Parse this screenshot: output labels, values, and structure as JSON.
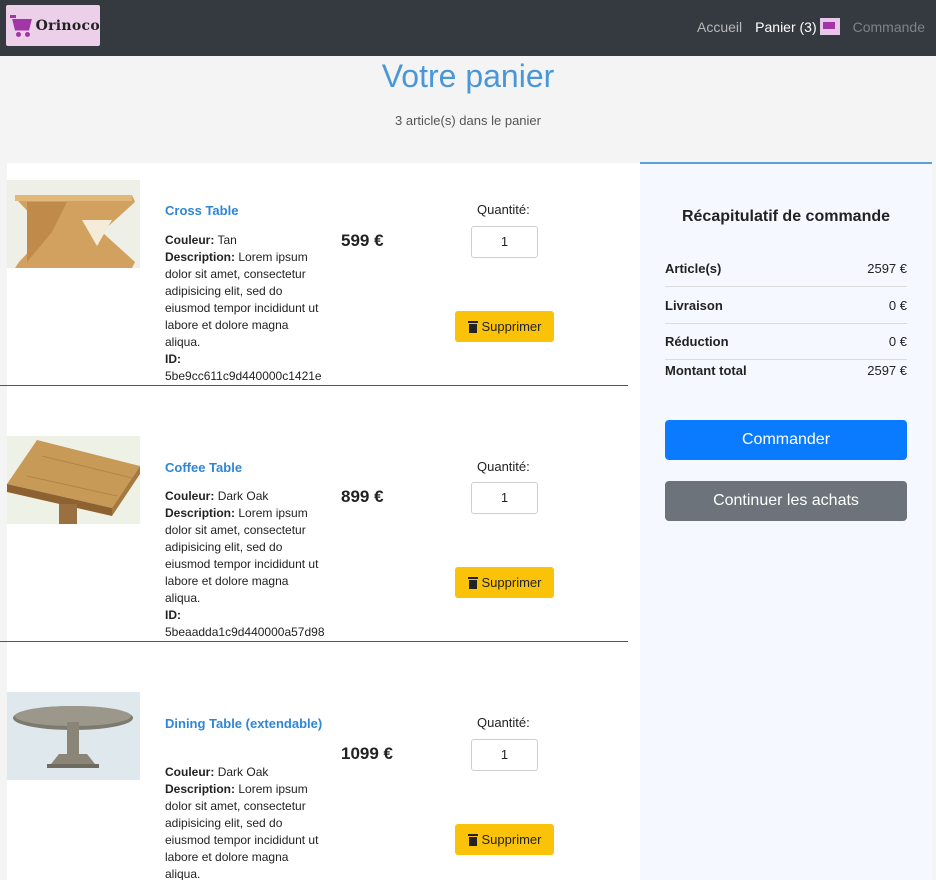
{
  "nav": {
    "logo_text": "Orinoco",
    "home": "Accueil",
    "cart": "Panier (3)",
    "order": "Commande"
  },
  "header": {
    "title": "Votre panier",
    "subtitle": "3 article(s) dans le panier"
  },
  "labels": {
    "color": "Couleur:",
    "description": "Description:",
    "id": "ID:",
    "quantity": "Quantité:",
    "delete": "Supprimer"
  },
  "items": [
    {
      "name": "Cross Table",
      "color": "Tan",
      "description": "Lorem ipsum dolor sit amet, consectetur adipisicing elit, sed do eiusmod tempor incididunt ut labore et dolore magna aliqua.",
      "id": "5be9cc611c9d440000c1421e",
      "price": "599 €",
      "quantity": "1"
    },
    {
      "name": "Coffee Table",
      "color": "Dark Oak",
      "description": "Lorem ipsum dolor sit amet, consectetur adipisicing elit, sed do eiusmod tempor incididunt ut labore et dolore magna aliqua.",
      "id": "5beaadda1c9d440000a57d98",
      "price": "899 €",
      "quantity": "1"
    },
    {
      "name": "Dining Table (extendable)",
      "color": "Dark Oak",
      "description": "Lorem ipsum dolor sit amet, consectetur adipisicing elit, sed do eiusmod tempor incididunt ut labore et dolore magna aliqua.",
      "price": "1099 €",
      "quantity": "1"
    }
  ],
  "summary": {
    "title": "Récapitulatif de commande",
    "articles_label": "Article(s)",
    "articles_value": "2597 €",
    "shipping_label": "Livraison",
    "shipping_value": "0 €",
    "discount_label": "Réduction",
    "discount_value": "0 €",
    "total_label": "Montant total",
    "total_value": "2597 €",
    "order_button": "Commander",
    "continue_button": "Continuer les achats"
  },
  "colors": {
    "navbar": "#343a40",
    "accent": "#4a97d8",
    "primary_button": "#0a7bff",
    "secondary_button": "#6c737a",
    "delete_button": "#fbc20a"
  },
  "icons": {
    "logo": "shopping-cart-logo",
    "cart": "cart-icon",
    "delete": "trash-icon"
  }
}
